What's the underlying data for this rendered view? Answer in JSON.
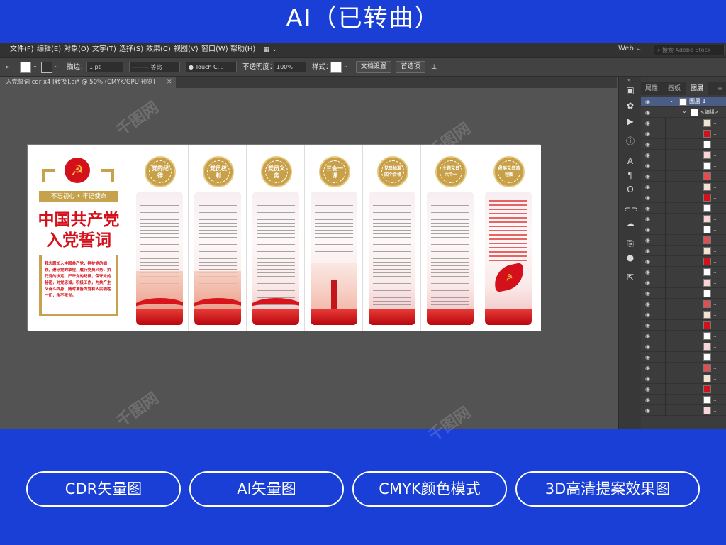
{
  "banner": {
    "title": "AI（已转曲）"
  },
  "menu": {
    "items": [
      "文件(F)",
      "编辑(E)",
      "对象(O)",
      "文字(T)",
      "选择(S)",
      "效果(C)",
      "视图(V)",
      "窗口(W)",
      "帮助(H)"
    ],
    "workspace": "Web",
    "stock_search_placeholder": "搜索 Adobe Stock"
  },
  "control": {
    "stroke_label": "描边：",
    "stroke_value": "1 pt",
    "stroke_profile": "等比",
    "brush": "Touch C...",
    "opacity_label": "不透明度：",
    "opacity_value": "100%",
    "style_label": "样式：",
    "doc_setup": "文档设置",
    "preferences": "首选项"
  },
  "document": {
    "tab_title": "入党誓词 cdr x4 [转换].ai* @ 50% (CMYK/GPU 预览)"
  },
  "artwork": {
    "slogan": "不忘初心 • 牢记使命",
    "title_line1": "中国共产党",
    "title_line2": "入党誓词",
    "oath": "我志愿加入中国共产党，拥护党的纲领，遵守党的章程，履行党员义务，执行党的决定，严守党的纪律，保守党的秘密，对党忠诚，积极工作，为共产主义奋斗终身，随时准备为党和人民牺牲一切，永不叛党。",
    "panels": [
      {
        "badge": "党的纪律"
      },
      {
        "badge": "党员权利"
      },
      {
        "badge": "党员义务"
      },
      {
        "badge": "三会一课"
      },
      {
        "badge": "党员标准 四个合格"
      },
      {
        "badge": "主题党日 六个一"
      },
      {
        "badge": "发展党员流程图"
      }
    ]
  },
  "layers_panel": {
    "tabs": [
      "属性",
      "画板",
      "图层"
    ],
    "active_tab": "图层",
    "top_layer": "图层 1",
    "group": "<编组>",
    "item_label": "..."
  },
  "features": [
    "CDR矢量图",
    "AI矢量图",
    "CMYK颜色模式",
    "3D高清提案效果图"
  ],
  "watermark": "千图网",
  "colors": {
    "brand_blue": "#1a3fd6",
    "party_red": "#d4111a",
    "gold": "#c5a24b",
    "ui_dark": "#535353"
  },
  "icons": [
    "transform-icon",
    "recolor-icon",
    "play-icon",
    "info-icon",
    "type-icon",
    "paragraph-icon",
    "glyph-icon",
    "link-icon",
    "cc-library-icon",
    "export-icon",
    "color-icon",
    "external-icon"
  ]
}
